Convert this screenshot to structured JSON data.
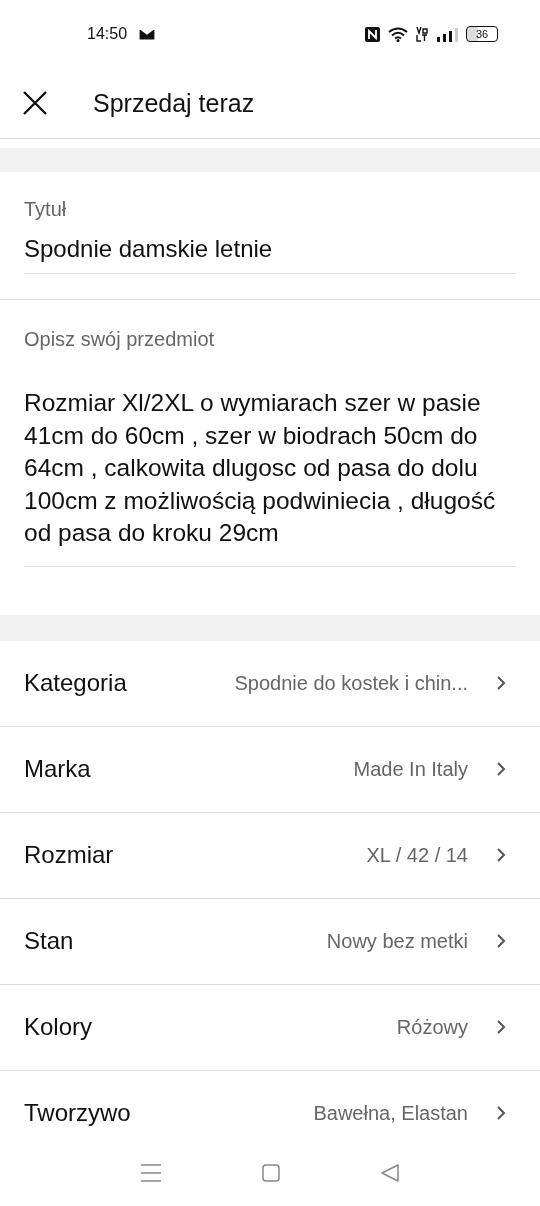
{
  "status_bar": {
    "time": "14:50",
    "battery": "36"
  },
  "header": {
    "title": "Sprzedaj teraz"
  },
  "title_field": {
    "label": "Tytuł",
    "value": "Spodnie damskie letnie"
  },
  "description_field": {
    "label": "Opisz swój przedmiot",
    "value": "Rozmiar Xl/2XL o wymiarach szer w pasie 41cm do 60cm , szer w biodrach 50cm do 64cm , calkowita dlugosc od pasa do dolu 100cm z możliwością podwiniecia , długość od pasa do kroku 29cm"
  },
  "attributes": [
    {
      "label": "Kategoria",
      "value": "Spodnie do kostek i chin..."
    },
    {
      "label": "Marka",
      "value": "Made In Italy"
    },
    {
      "label": "Rozmiar",
      "value": "XL / 42 / 14"
    },
    {
      "label": "Stan",
      "value": "Nowy bez metki"
    },
    {
      "label": "Kolory",
      "value": "Różowy"
    },
    {
      "label": "Tworzywo",
      "value": "Bawełna, Elastan"
    }
  ]
}
